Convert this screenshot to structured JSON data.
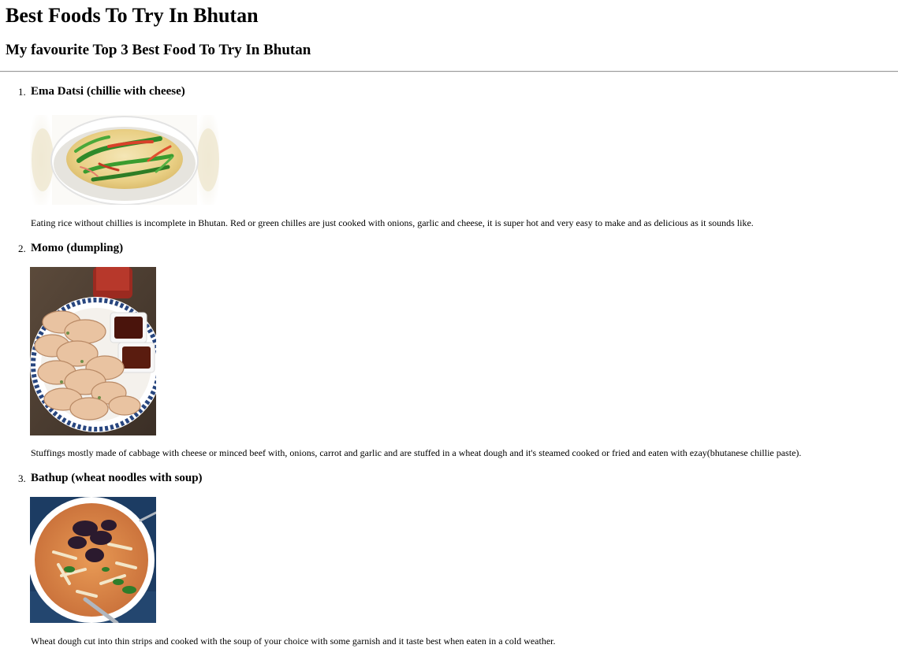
{
  "page": {
    "title": "Best Foods To Try In Bhutan",
    "subtitle": "My favourite Top 3 Best Food To Try In Bhutan"
  },
  "foods": [
    {
      "number": "1.",
      "name": "Ema Datsi (chillie with cheese)",
      "image": "ema-datsi-photo",
      "description": "Eating rice without chillies is incomplete in Bhutan. Red or green chilles are just cooked with onions, garlic and cheese, it is super hot and very easy to make and as delicious as it sounds like."
    },
    {
      "number": "2.",
      "name": "Momo (dumpling)",
      "image": "momo-photo",
      "description": "Stuffings mostly made of cabbage with cheese or minced beef with, onions, carrot and garlic and are stuffed in a wheat dough and it's steamed cooked or fried and eaten with ezay(bhutanese chillie paste)."
    },
    {
      "number": "3.",
      "name": "Bathup (wheat noodles with soup)",
      "image": "bathup-photo",
      "description": "Wheat dough cut into thin strips and cooked with the soup of your choice with some garnish and it taste best when eaten in a cold weather."
    }
  ],
  "colors": {
    "divider": "#9a9a9a",
    "text": "#000000",
    "background": "#ffffff"
  }
}
